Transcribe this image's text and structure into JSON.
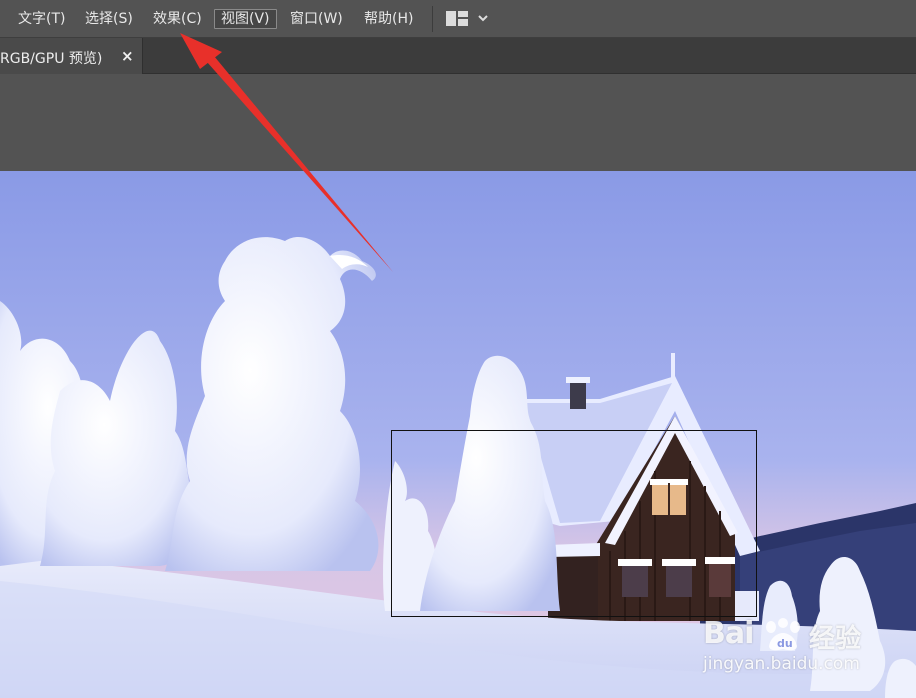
{
  "menubar": {
    "items": [
      {
        "label": "文字(T)"
      },
      {
        "label": "选择(S)"
      },
      {
        "label": "效果(C)"
      },
      {
        "label": "视图(V)"
      },
      {
        "label": "窗口(W)"
      },
      {
        "label": "帮助(H)"
      }
    ],
    "active_item": "视图(V)",
    "workspace_icon": "grid-layout-icon"
  },
  "document_tab": {
    "title": "RGB/GPU 预览)",
    "close_glyph": "×"
  },
  "watermark": {
    "brand": "Bai",
    "brand_suffix": "经验",
    "url": "jingyan.baidu.com"
  },
  "colors": {
    "ui_background": "#535353",
    "tabbar_background": "#3c3c3c",
    "annotation_arrow": "#e8302a",
    "selection_stroke": "#111111"
  }
}
